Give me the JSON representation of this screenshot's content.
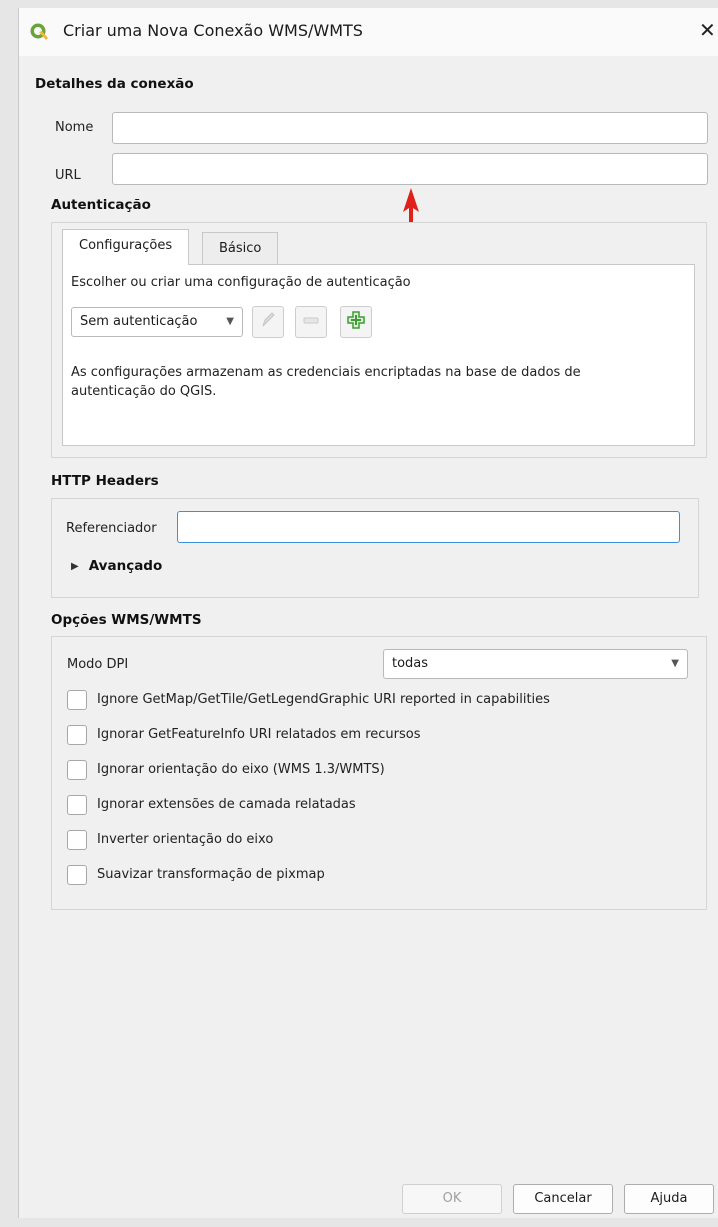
{
  "window": {
    "title": "Criar uma Nova Conexão WMS/WMTS",
    "close_icon": "close-icon",
    "app_icon": "qgis-icon"
  },
  "connection_details": {
    "title": "Detalhes da conexão",
    "name_label": "Nome",
    "name_value": "",
    "url_label": "URL",
    "url_value": ""
  },
  "annotation": {
    "arrow_color": "#e0201a",
    "arrow_icon": "red-arrow-up-icon"
  },
  "authentication": {
    "title": "Autenticação",
    "tabs": [
      {
        "label": "Configurações",
        "active": true
      },
      {
        "label": "Básico",
        "active": false
      }
    ],
    "choose_text": "Escolher ou criar uma configuração de autenticação",
    "combo_value": "Sem autenticação",
    "edit_icon": "pencil-icon",
    "remove_icon": "remove-icon",
    "add_icon": "add-plus-icon",
    "info_text_line1": "As configurações armazenam as credenciais encriptadas na base de dados de",
    "info_text_line2": "autenticação do QGIS."
  },
  "http_headers": {
    "title": "HTTP Headers",
    "referer_label": "Referenciador",
    "referer_value": "",
    "advanced_label": "Avançado"
  },
  "wms_options": {
    "title": "Opções WMS/WMTS",
    "dpi_label": "Modo DPI",
    "dpi_value": "todas",
    "checkboxes": [
      {
        "label": "Ignore GetMap/GetTile/GetLegendGraphic URI reported in capabilities",
        "checked": false
      },
      {
        "label": "Ignorar GetFeatureInfo URI relatados em recursos",
        "checked": false
      },
      {
        "label": "Ignorar orientação do eixo (WMS 1.3/WMTS)",
        "checked": false
      },
      {
        "label": "Ignorar extensões de camada relatadas",
        "checked": false
      },
      {
        "label": "Inverter orientação do eixo",
        "checked": false
      },
      {
        "label": "Suavizar transformação de pixmap",
        "checked": false
      }
    ]
  },
  "buttons": {
    "ok": "OK",
    "cancel": "Cancelar",
    "help": "Ajuda"
  },
  "colors": {
    "accent_focus": "#3e8ede",
    "add_icon_green": "#3f9b35"
  }
}
